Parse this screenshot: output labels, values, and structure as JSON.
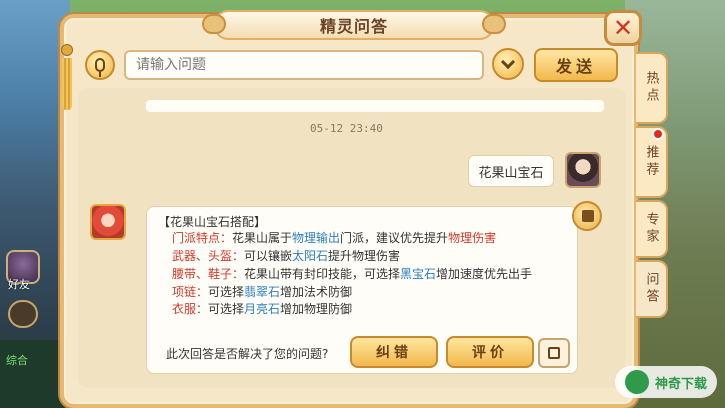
{
  "dialog": {
    "title": "精灵问答"
  },
  "input": {
    "placeholder": "请输入问题",
    "send_label": "发送"
  },
  "chat": {
    "timestamp": "05-12 23:40",
    "user_message": "花果山宝石",
    "answer": {
      "title": "【花果山宝石搭配】",
      "lines": [
        {
          "label": "门派特点：",
          "parts": [
            {
              "text": "花果山属于",
              "style": ""
            },
            {
              "text": "物理输出",
              "style": "blue"
            },
            {
              "text": "门派，建议优先提升",
              "style": ""
            },
            {
              "text": "物理伤害",
              "style": "red"
            }
          ]
        },
        {
          "label": "武器、头盔：",
          "parts": [
            {
              "text": "可以镶嵌",
              "style": ""
            },
            {
              "text": "太阳石",
              "style": "blue"
            },
            {
              "text": "提升物理伤害",
              "style": ""
            }
          ]
        },
        {
          "label": "腰带、鞋子：",
          "parts": [
            {
              "text": "花果山带有封印技能，可选择",
              "style": ""
            },
            {
              "text": "黑宝石",
              "style": "blue"
            },
            {
              "text": "增加速度优先出手",
              "style": ""
            }
          ]
        },
        {
          "label": "项链：",
          "parts": [
            {
              "text": "可选择",
              "style": ""
            },
            {
              "text": "翡翠石",
              "style": "blue"
            },
            {
              "text": "增加法术防御",
              "style": ""
            }
          ]
        },
        {
          "label": "衣服：",
          "parts": [
            {
              "text": "可选择",
              "style": ""
            },
            {
              "text": "月亮石",
              "style": "blue"
            },
            {
              "text": "增加物理防御",
              "style": ""
            }
          ]
        }
      ]
    },
    "feedback_question": "此次回答是否解决了您的问题?",
    "wrong_label": "纠错",
    "rate_label": "评价"
  },
  "side_tabs": [
    {
      "label": "热点",
      "active": false
    },
    {
      "label": "推荐",
      "active": false,
      "badge": true
    },
    {
      "label": "专家",
      "active": false
    },
    {
      "label": "问答",
      "active": true
    }
  ],
  "background": {
    "friend_label": "好友",
    "side_text": "综合"
  },
  "watermark": {
    "text": "神奇下载"
  },
  "colors": {
    "accent": "#f2b84c",
    "label_red": "#d33a2a",
    "link_blue": "#2a7fc0",
    "panel": "#f6e7c9"
  }
}
